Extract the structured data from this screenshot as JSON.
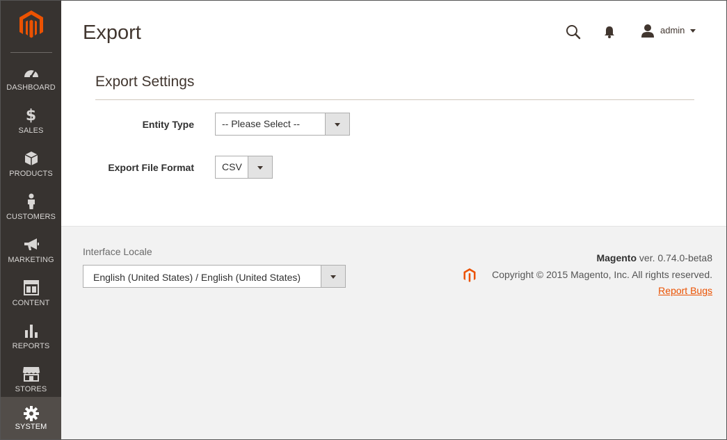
{
  "header": {
    "title": "Export",
    "user": "admin",
    "icons": [
      "search-icon",
      "bell-icon",
      "user-icon"
    ]
  },
  "sidebar": {
    "items": [
      {
        "label": "DASHBOARD",
        "icon": "dashboard-icon"
      },
      {
        "label": "SALES",
        "icon": "dollar-icon"
      },
      {
        "label": "PRODUCTS",
        "icon": "box-icon"
      },
      {
        "label": "CUSTOMERS",
        "icon": "person-icon"
      },
      {
        "label": "MARKETING",
        "icon": "megaphone-icon"
      },
      {
        "label": "CONTENT",
        "icon": "layout-icon"
      },
      {
        "label": "REPORTS",
        "icon": "bar-chart-icon"
      },
      {
        "label": "STORES",
        "icon": "storefront-icon"
      },
      {
        "label": "SYSTEM",
        "icon": "gear-icon",
        "active": true
      }
    ]
  },
  "settings": {
    "title": "Export Settings",
    "entity_type": {
      "label": "Entity Type",
      "value": "-- Please Select --"
    },
    "file_format": {
      "label": "Export File Format",
      "value": "CSV"
    }
  },
  "footer": {
    "locale_label": "Interface Locale",
    "locale_value": "English (United States) / English (United States)",
    "brand": "Magento",
    "version": "ver. 0.74.0-beta8",
    "copyright": "Copyright © 2015 Magento, Inc. All rights reserved.",
    "report_bugs": "Report Bugs"
  },
  "colors": {
    "sidebar_bg": "#373330",
    "active_bg": "#524d49",
    "accent": "#eb5202",
    "footer_bg": "#f2f2f2"
  }
}
